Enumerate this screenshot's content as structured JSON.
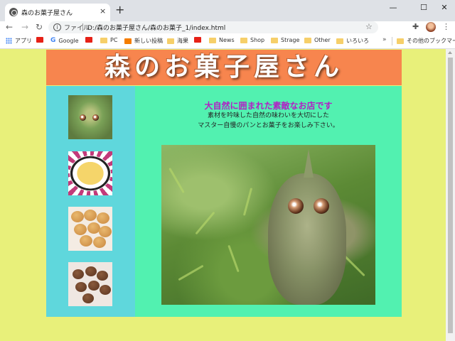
{
  "browser": {
    "tab_title": "森のお菓子屋さん",
    "tab_close": "×",
    "new_tab": "+",
    "window_controls": {
      "minimize": "—",
      "maximize": "☐",
      "close": "✕"
    },
    "nav": {
      "back": "←",
      "forward": "→",
      "reload": "↻"
    },
    "omnibox": {
      "security_label": "ファイル",
      "url": "D:/森のお菓子屋さん/森のお菓子_1/index.html"
    },
    "icons": {
      "star": "☆",
      "extensions": "✚",
      "menu": "⋮",
      "info": "i"
    },
    "bookmarks": [
      {
        "label": "アプリ",
        "icon": "apps-icon"
      },
      {
        "label": "",
        "icon": "youtube-icon"
      },
      {
        "label": "Google",
        "icon": "google-icon"
      },
      {
        "label": "",
        "icon": "youtube-icon"
      },
      {
        "label": "PC",
        "icon": "folder-icon"
      },
      {
        "label": "新しい投稿",
        "icon": "blogger-icon"
      },
      {
        "label": "海果",
        "icon": "folder-icon"
      },
      {
        "label": "",
        "icon": "youtube-icon"
      },
      {
        "label": "News",
        "icon": "folder-icon"
      },
      {
        "label": "Shop",
        "icon": "folder-icon"
      },
      {
        "label": "Strage",
        "icon": "folder-icon"
      },
      {
        "label": "Other",
        "icon": "folder-icon"
      },
      {
        "label": "いろいろ",
        "icon": "folder-icon"
      }
    ],
    "bookmarks_more": "»",
    "other_bookmarks": "その他のブックマーク"
  },
  "page": {
    "title": "森のお菓子屋さん",
    "heading": "大自然に囲まれた素敵なお店です",
    "subtext_line1": "素材を吟味した自然の味わいを大切にした",
    "subtext_line2": "マスター自慢のパンとお菓子をお楽しみ下さい。",
    "colors": {
      "background": "#e8f07a",
      "header": "#f7854e",
      "sidebar": "#5fd7dc",
      "main": "#52f1b0",
      "heading_text": "#b21fc4"
    },
    "sidebar_images": [
      "creature-thumbnail",
      "omelette-plate-thumbnail",
      "cookies-plate-thumbnail",
      "chocolate-cookies-thumbnail"
    ],
    "hero_image": "creature-in-greenery-photo"
  }
}
